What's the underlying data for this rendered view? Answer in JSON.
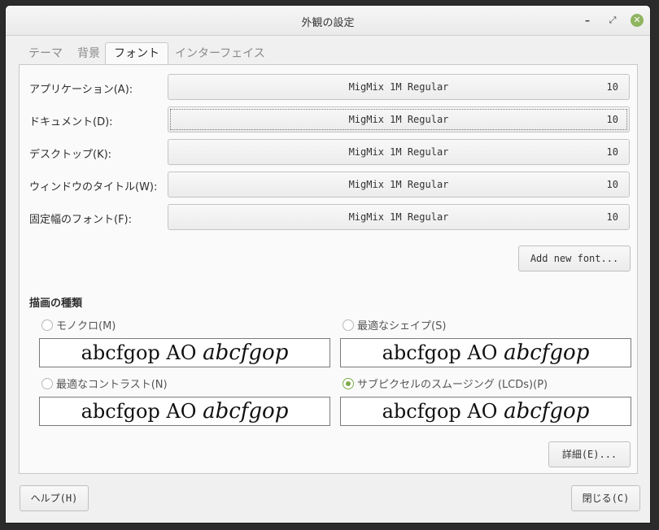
{
  "window": {
    "title": "外観の設定"
  },
  "tabs": [
    "テーマ",
    "背景",
    "フォント",
    "インターフェイス"
  ],
  "fonts": [
    {
      "label": "アプリケーション(A):",
      "name": "MigMix 1M Regular",
      "size": "10"
    },
    {
      "label": "ドキュメント(D):",
      "name": "MigMix 1M Regular",
      "size": "10"
    },
    {
      "label": "デスクトップ(K):",
      "name": "MigMix 1M Regular",
      "size": "10"
    },
    {
      "label": "ウィンドウのタイトル(W):",
      "name": "MigMix 1M Regular",
      "size": "10"
    },
    {
      "label": "固定幅のフォント(F):",
      "name": "MigMix 1M Regular",
      "size": "10"
    }
  ],
  "add_font_label": "Add new font...",
  "rendering": {
    "title": "描画の種類",
    "options": [
      {
        "label": "モノクロ(M)",
        "selected": false,
        "preview_regular": "abcfgop AO",
        "preview_italic": "abcfgop"
      },
      {
        "label": "最適なシェイプ(S)",
        "selected": false,
        "preview_regular": "abcfgop AO",
        "preview_italic": "abcfgop"
      },
      {
        "label": "最適なコントラスト(N)",
        "selected": false,
        "preview_regular": "abcfgop AO",
        "preview_italic": "abcfgop"
      },
      {
        "label": "サブピクセルのスムージング (LCDs)(P)",
        "selected": true,
        "preview_regular": "abcfgop AO",
        "preview_italic": "abcfgop"
      }
    ]
  },
  "details_label": "詳細(E)...",
  "footer": {
    "help_label": "ヘルプ(H)",
    "close_label": "閉じる(C)"
  },
  "colors": {
    "accent": "#7fa94e",
    "close_button": "#8fb560"
  }
}
